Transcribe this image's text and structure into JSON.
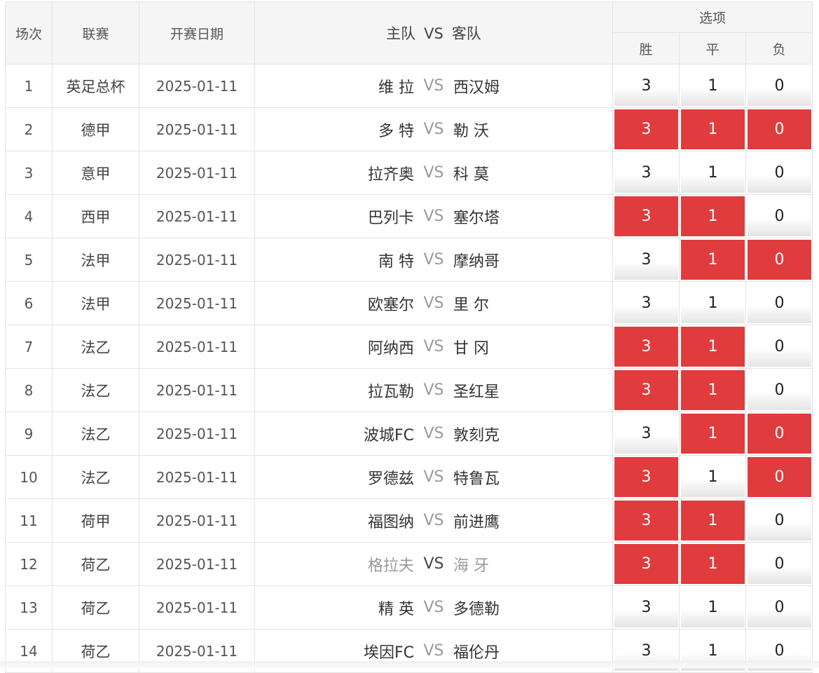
{
  "header": {
    "idx": "场次",
    "league": "联赛",
    "date": "开赛日期",
    "home": "主队",
    "vs": "VS",
    "away": "客队",
    "options": "选项",
    "win": "胜",
    "draw": "平",
    "lose": "负"
  },
  "rows": [
    {
      "idx": "1",
      "league": "英足总杯",
      "date": "2025-01-11",
      "home": "维 拉",
      "vs": "VS",
      "away": "西汉姆",
      "win": "3",
      "draw": "1",
      "lose": "0",
      "sel": [
        false,
        false,
        false
      ],
      "dim": false
    },
    {
      "idx": "2",
      "league": "德甲",
      "date": "2025-01-11",
      "home": "多 特",
      "vs": "VS",
      "away": "勒 沃",
      "win": "3",
      "draw": "1",
      "lose": "0",
      "sel": [
        true,
        true,
        true
      ],
      "dim": false
    },
    {
      "idx": "3",
      "league": "意甲",
      "date": "2025-01-11",
      "home": "拉齐奥",
      "vs": "VS",
      "away": "科 莫",
      "win": "3",
      "draw": "1",
      "lose": "0",
      "sel": [
        false,
        false,
        false
      ],
      "dim": false
    },
    {
      "idx": "4",
      "league": "西甲",
      "date": "2025-01-11",
      "home": "巴列卡",
      "vs": "VS",
      "away": "塞尔塔",
      "win": "3",
      "draw": "1",
      "lose": "0",
      "sel": [
        true,
        true,
        false
      ],
      "dim": false
    },
    {
      "idx": "5",
      "league": "法甲",
      "date": "2025-01-11",
      "home": "南 特",
      "vs": "VS",
      "away": "摩纳哥",
      "win": "3",
      "draw": "1",
      "lose": "0",
      "sel": [
        false,
        true,
        true
      ],
      "dim": false
    },
    {
      "idx": "6",
      "league": "法甲",
      "date": "2025-01-11",
      "home": "欧塞尔",
      "vs": "VS",
      "away": "里 尔",
      "win": "3",
      "draw": "1",
      "lose": "0",
      "sel": [
        false,
        false,
        false
      ],
      "dim": false
    },
    {
      "idx": "7",
      "league": "法乙",
      "date": "2025-01-11",
      "home": "阿纳西",
      "vs": "VS",
      "away": "甘 冈",
      "win": "3",
      "draw": "1",
      "lose": "0",
      "sel": [
        true,
        true,
        false
      ],
      "dim": false
    },
    {
      "idx": "8",
      "league": "法乙",
      "date": "2025-01-11",
      "home": "拉瓦勒",
      "vs": "VS",
      "away": "圣红星",
      "win": "3",
      "draw": "1",
      "lose": "0",
      "sel": [
        true,
        true,
        false
      ],
      "dim": false
    },
    {
      "idx": "9",
      "league": "法乙",
      "date": "2025-01-11",
      "home": "波城FC",
      "vs": "VS",
      "away": "敦刻克",
      "win": "3",
      "draw": "1",
      "lose": "0",
      "sel": [
        false,
        true,
        true
      ],
      "dim": false
    },
    {
      "idx": "10",
      "league": "法乙",
      "date": "2025-01-11",
      "home": "罗德兹",
      "vs": "VS",
      "away": "特鲁瓦",
      "win": "3",
      "draw": "1",
      "lose": "0",
      "sel": [
        true,
        false,
        true
      ],
      "dim": false
    },
    {
      "idx": "11",
      "league": "荷甲",
      "date": "2025-01-11",
      "home": "福图纳",
      "vs": "VS",
      "away": "前进鹰",
      "win": "3",
      "draw": "1",
      "lose": "0",
      "sel": [
        true,
        true,
        false
      ],
      "dim": false
    },
    {
      "idx": "12",
      "league": "荷乙",
      "date": "2025-01-11",
      "home": "格拉夫",
      "vs": "VS",
      "away": "海 牙",
      "win": "3",
      "draw": "1",
      "lose": "0",
      "sel": [
        true,
        true,
        false
      ],
      "dim": true
    },
    {
      "idx": "13",
      "league": "荷乙",
      "date": "2025-01-11",
      "home": "精 英",
      "vs": "VS",
      "away": "多德勒",
      "win": "3",
      "draw": "1",
      "lose": "0",
      "sel": [
        false,
        false,
        false
      ],
      "dim": false
    },
    {
      "idx": "14",
      "league": "荷乙",
      "date": "2025-01-11",
      "home": "埃因FC",
      "vs": "VS",
      "away": "福伦丹",
      "win": "3",
      "draw": "1",
      "lose": "0",
      "sel": [
        false,
        false,
        false
      ],
      "dim": false
    }
  ],
  "colors": {
    "selected": "#e03c3e",
    "header_bg": "#f5f5f5",
    "border": "#e3e3e3"
  }
}
